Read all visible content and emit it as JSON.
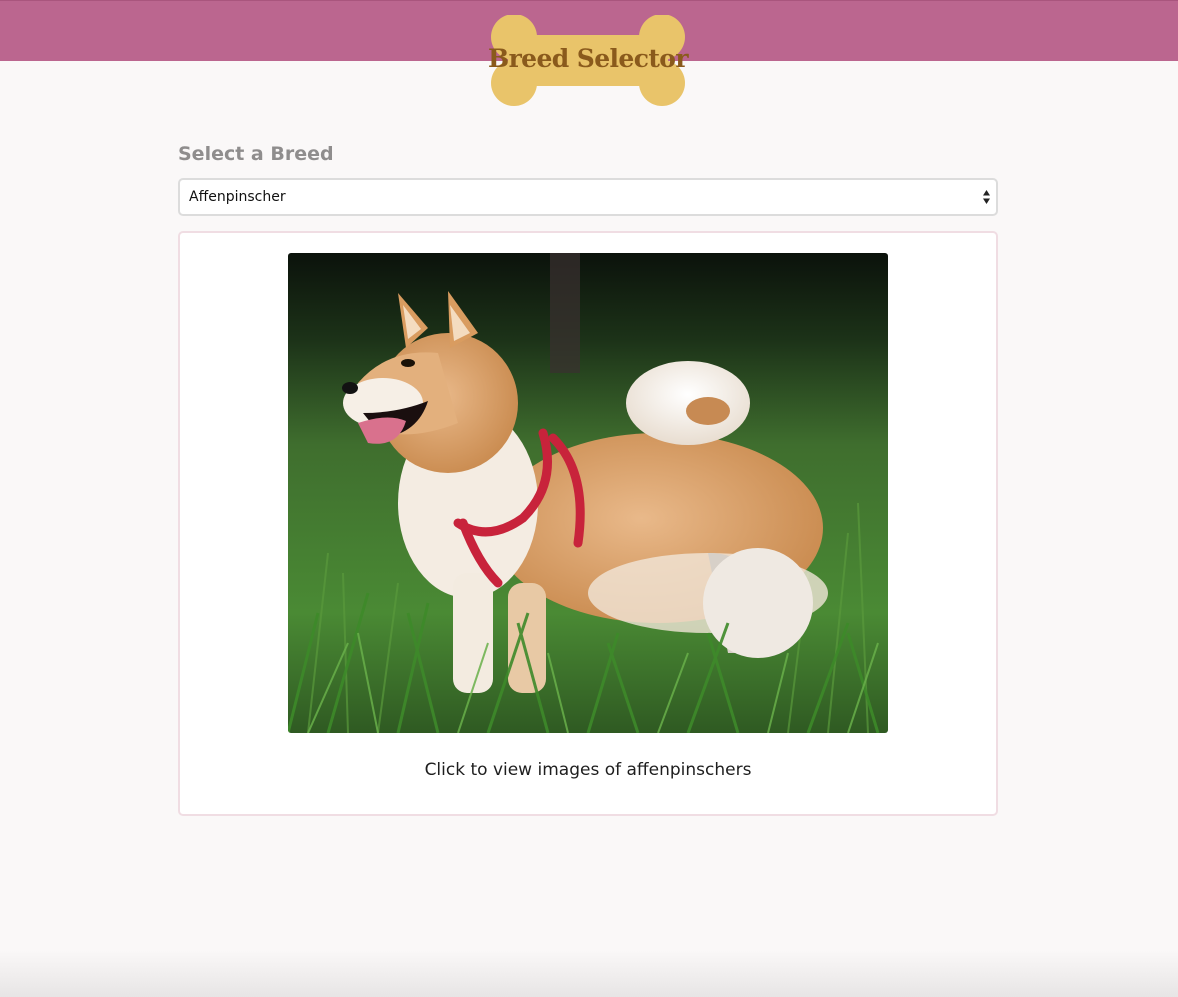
{
  "header": {
    "logo_text": "Breed Selector",
    "bar_color": "#bb668f",
    "bone_color": "#e9c46a"
  },
  "breed_select": {
    "label": "Select a Breed",
    "selected": "Affenpinscher"
  },
  "card": {
    "image_alt": "Dog standing in grass wearing a red harness",
    "caption": "Click to view images of affenpinschers"
  },
  "icons": {
    "select_arrows": "up-down-arrows-icon"
  }
}
